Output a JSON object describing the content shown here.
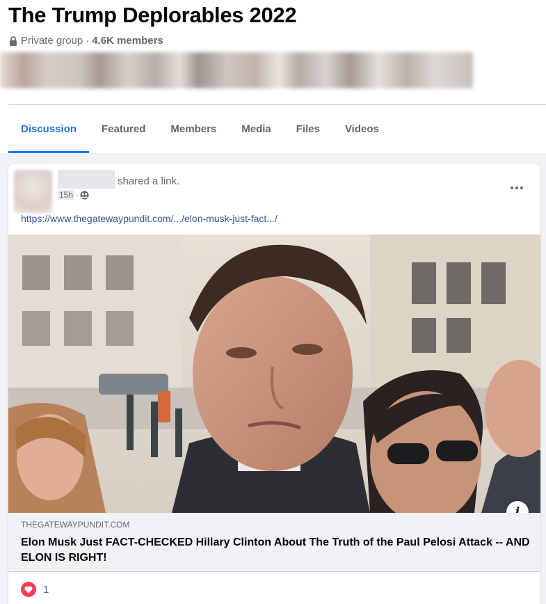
{
  "group": {
    "title": "The Trump Deplorables 2022",
    "privacy": "Private group",
    "separator": "·",
    "members": "4.6K members"
  },
  "tabs": [
    {
      "label": "Discussion",
      "active": true
    },
    {
      "label": "Featured",
      "active": false
    },
    {
      "label": "Members",
      "active": false
    },
    {
      "label": "Media",
      "active": false
    },
    {
      "label": "Files",
      "active": false
    },
    {
      "label": "Videos",
      "active": false
    }
  ],
  "post": {
    "action": "shared a link.",
    "time": "15h",
    "dot": "·",
    "audience_icon": "group-icon",
    "url": "https://www.thegatewaypundit.com/.../elon-musk-just-fact.../",
    "link_preview": {
      "domain": "THEGATEWAYPUNDIT.COM",
      "title": "Elon Musk Just FACT-CHECKED Hillary Clinton About The Truth of the Paul Pelosi Attack -- AND ELON IS RIGHT!"
    },
    "info_label": "i",
    "reaction_count": "1"
  },
  "colors": {
    "accent": "#1877f2",
    "link": "#385898",
    "love": "#f33e58",
    "secondary_text": "#65676b"
  }
}
